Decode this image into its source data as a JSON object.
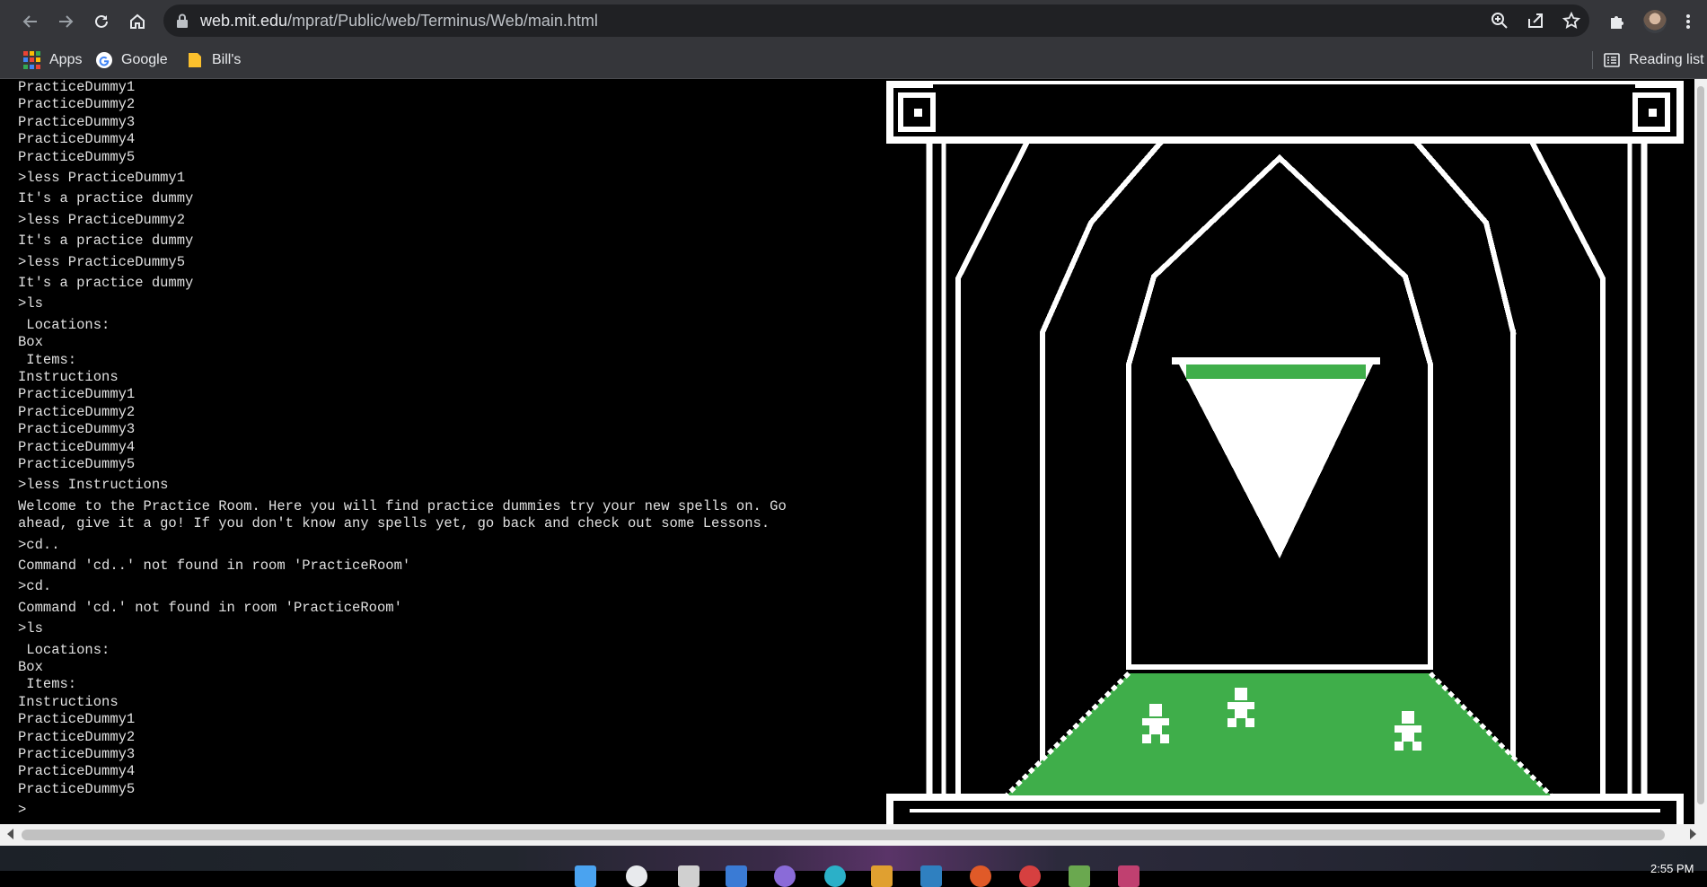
{
  "browser": {
    "url_host": "web.mit.edu",
    "url_path": "/mprat/Public/web/Terminus/Web/main.html",
    "nav_icons": [
      "back-icon",
      "forward-icon",
      "reload-icon",
      "home-icon"
    ],
    "omnibox_icons": [
      "zoom-icon",
      "share-icon",
      "star-icon"
    ],
    "toolbar_icons": [
      "extensions-icon",
      "avatar",
      "menu-icon"
    ]
  },
  "bookmarks": {
    "apps": "Apps",
    "google": "Google",
    "bills": "Bill's",
    "reading_list": "Reading list"
  },
  "terminal": {
    "lines": [
      "PracticeDummy1",
      "PracticeDummy2",
      "PracticeDummy3",
      "PracticeDummy4",
      "PracticeDummy5",
      ">less PracticeDummy1",
      "It's a practice dummy",
      ">less PracticeDummy2",
      "It's a practice dummy",
      ">less PracticeDummy5",
      "It's a practice dummy",
      ">ls",
      " Locations:",
      "Box",
      " Items:",
      "Instructions",
      "PracticeDummy1",
      "PracticeDummy2",
      "PracticeDummy3",
      "PracticeDummy4",
      "PracticeDummy5",
      ">less Instructions",
      "Welcome to the Practice Room. Here you will find practice dummies try your new spells on. Go",
      "ahead, give it a go! If you don't know any spells yet, go back and check out some Lessons.",
      ">cd..",
      "Command 'cd..' not found in room 'PracticeRoom'",
      ">cd.",
      "Command 'cd.' not found in room 'PracticeRoom'",
      ">ls",
      " Locations:",
      "Box",
      " Items:",
      "Instructions",
      "PracticeDummy1",
      "PracticeDummy2",
      "PracticeDummy3",
      "PracticeDummy4",
      "PracticeDummy5"
    ],
    "prompt": ">"
  },
  "taskbar": {
    "clock": "2:55 PM"
  },
  "colors": {
    "terminal_bg": "#000000",
    "terminal_text": "#e0e0e0",
    "art_green": "#3fae4a",
    "art_white": "#ffffff"
  }
}
